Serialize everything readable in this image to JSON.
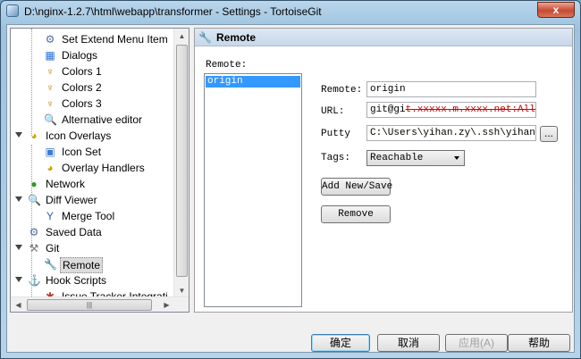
{
  "window": {
    "title": "D:\\nginx-1.2.7\\html\\webapp\\transformer - Settings - TortoiseGit",
    "close_glyph": "x"
  },
  "tree": {
    "items": [
      {
        "label": "Set Extend Menu Item",
        "icon": "gear-icon"
      },
      {
        "label": "Dialogs",
        "icon": "windows-icon"
      },
      {
        "label": "Colors 1",
        "icon": "palette-icon"
      },
      {
        "label": "Colors 2",
        "icon": "palette-icon"
      },
      {
        "label": "Colors 3",
        "icon": "palette-icon"
      },
      {
        "label": "Alternative editor",
        "icon": "magnifier-icon"
      },
      {
        "label": "Icon Overlays",
        "icon": "overlay-icon"
      },
      {
        "label": "Icon Set",
        "icon": "iconset-icon"
      },
      {
        "label": "Overlay Handlers",
        "icon": "overlay-icon"
      },
      {
        "label": "Network",
        "icon": "globe-icon"
      },
      {
        "label": "Diff Viewer",
        "icon": "magnifier-icon"
      },
      {
        "label": "Merge Tool",
        "icon": "merge-icon"
      },
      {
        "label": "Saved Data",
        "icon": "gear-icon"
      },
      {
        "label": "Git",
        "icon": "tools-icon"
      },
      {
        "label": "Remote",
        "icon": "wrench-icon"
      },
      {
        "label": "Hook Scripts",
        "icon": "hook-icon"
      },
      {
        "label": "Issue Tracker Integrati",
        "icon": "bug-icon"
      }
    ]
  },
  "panel": {
    "title": "Remote",
    "remote_list_label": "Remote:",
    "remotes": [
      "origin"
    ],
    "remote_label": "Remote:",
    "remote_value": "origin",
    "url_label": "URL:",
    "url_prefix": "git@gi",
    "url_redacted": "t.xxxxx.m.xxxx.net:AllSpark",
    "putty_label": "Putty",
    "putty_value": "C:\\Users\\yihan.zy\\.ssh\\yihan.ppk",
    "browse_label": "...",
    "tags_label": "Tags:",
    "tags_value": "Reachable",
    "add_label": "Add New/Save",
    "remove_label": "Remove"
  },
  "footer": {
    "ok": "确定",
    "cancel": "取消",
    "apply": "应用(A)",
    "help": "帮助"
  }
}
